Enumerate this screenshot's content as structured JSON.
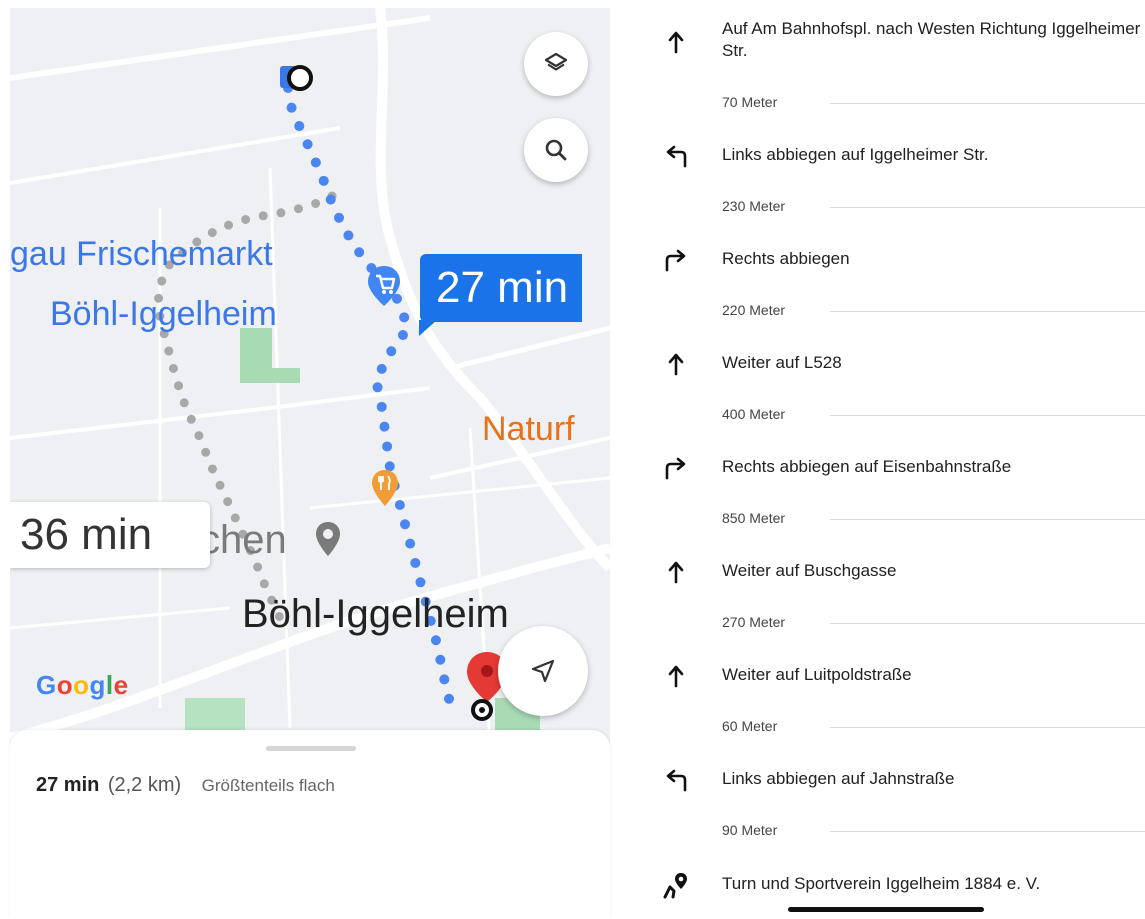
{
  "map": {
    "poi_name": "gau Frischemarkt",
    "poi_city": "Böhl-Iggelheim",
    "route_time_primary": "27 min",
    "nature_label": "Naturf",
    "route_time_alternative": "36 min",
    "poi_partial": "chen",
    "town_label": "Böhl-Iggelheim",
    "google_logo": [
      "G",
      "o",
      "o",
      "g",
      "l",
      "e"
    ],
    "google_colors": [
      "#4285f4",
      "#ea4335",
      "#fbbc05",
      "#4285f4",
      "#34a853",
      "#ea4335"
    ],
    "route_color": "#4a85f0",
    "alt_route_color": "#a8a8a8"
  },
  "sheet": {
    "duration": "27 min",
    "distance": "(2,2 km)",
    "terrain": "Größtenteils flach"
  },
  "steps": [
    {
      "icon": "arrow-up-icon",
      "text": "Auf Am Bahnhofspl. nach Westen Richtung Iggelheimer Str.",
      "distance": "70 Meter"
    },
    {
      "icon": "turn-left-icon",
      "text": "Links abbiegen auf Iggelheimer Str.",
      "distance": "230 Meter"
    },
    {
      "icon": "turn-right-icon",
      "text": "Rechts abbiegen",
      "distance": "220 Meter"
    },
    {
      "icon": "arrow-up-icon",
      "text": "Weiter auf L528",
      "distance": "400 Meter"
    },
    {
      "icon": "turn-right-icon",
      "text": "Rechts abbiegen auf Eisenbahnstraße",
      "distance": "850 Meter"
    },
    {
      "icon": "arrow-up-icon",
      "text": "Weiter auf Buschgasse",
      "distance": "270 Meter"
    },
    {
      "icon": "arrow-up-icon",
      "text": "Weiter auf Luitpoldstraße",
      "distance": "60 Meter"
    },
    {
      "icon": "turn-left-icon",
      "text": "Links abbiegen auf Jahnstraße",
      "distance": "90 Meter"
    }
  ],
  "destination": {
    "icon": "destination-walk-icon",
    "text": "Turn und Sportverein Iggelheim 1884 e. V."
  }
}
